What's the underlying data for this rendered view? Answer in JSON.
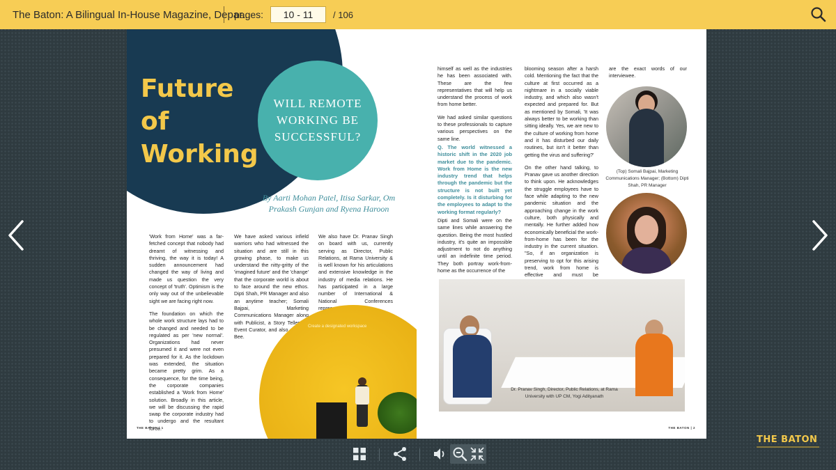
{
  "topbar": {
    "doc_title": "The Baton: A Bilingual In-House Magazine, Depar...",
    "pages_label": "pages:",
    "page_value": "10 - 11",
    "page_total": "/ 106",
    "search_icon": "search-icon"
  },
  "nav": {
    "prev_icon": "chevron-left-icon",
    "next_icon": "chevron-right-icon"
  },
  "spread": {
    "title_line1": "Future",
    "title_line2": "of",
    "title_line3": "Working",
    "teal_heading": "WILL REMOTE WORKING BE SUCCESSFUL?",
    "byline": "By Aarti Mohan Patel, Itisa Sarkar, Om Prakash Gunjan and Ryena Haroon",
    "col1_p1": "'Work from Home' was a far-fetched concept that nobody had dreamt of witnessing and thriving, the way it is today! A sudden announcement had changed the way of living and made us question the very concept of 'truth'. Optimism is the only way out of the unbelievable sight we are facing right now.",
    "col1_p2": "The foundation on which the whole work structure lays had to be changed and needed to be regulated as per 'new normal'. Organizations had never presumed it and were not even prepared for it. As the lockdown was extended, the situation became pretty grim. As a consequence, for the time being, the corporate companies established a 'Work from Home' solution. Broadly in this article, we will be discussing the rapid swap the corporate industry had to undergo and the resultant force.",
    "col2_p1": "We have asked various infield warriors who had witnessed the situation and are still in this growing phase, to make us understand the nitty-gritty of the 'imagined future' and the 'change' that the corporate world is about to face around the new ethos. Dipti Shah, PR Manager and also an anytime teacher; Somali Bajpai, Marketing Communications Manager along with Publicist, a Story Teller, an Event Curator, and also a Digital Bee.",
    "col3_p1": "We also have Dr. Pranav Singh on board with us, currently serving as Director, Public Relations, at Rama University & is well known for his articulations and extensive knowledge in the industry of media relations. He has participated in a large number of International & National Conferences representing",
    "yellow_caption": "Create a designated workspace",
    "footer_left": "THE BATON | 1",
    "footer_right": "THE BATON | 2",
    "rcol1_p1": "himself as well as the industries he has been associated with. These are the few representatives that will help us understand the process of work from home better.",
    "rcol1_p2": "We had asked similar questions to these professionals to capture various perspectives on the same line.",
    "question": "Q. The world witnessed a historic shift in the 2020 job market due to the pandemic. Work from Home is the new industry trend that helps through the pandemic but the structure is not built yet completely. Is it disturbing for the employees to adapt to the working format regularly?",
    "rcol1_p3": "Dipti and Somali were on the same lines while answering the question. Being the most hustled industry, it's quite an impossible adjustment to not do anything until an indefinite time period. They both portray work-from-home as the occurrence of the",
    "rcol2_p1": "blooming season after a harsh cold. Mentioning the fact that the culture at first occurred as a nightmare in a socially viable industry, and which also wasn't expected and prepared for. But as mentioned by Somali, 'It was always better to be working than sitting ideally. Yes, we are new to the culture of working from home and it has disturbed our daily routines, but isn't it better than getting the virus and suffering?'",
    "rcol2_p2": "On the other hand talking, to Pranav gave us another direction to think upon. He acknowledges the struggle employees have to face while adapting to the new pandemic situation and the approaching change in the work culture, both physically and mentally. He further added how economically beneficial the work-from-home has been for the industry in the current situation. \"So, if an organization is preserving to opt for this arising trend, work from home is effective and must be implemented by all.\"",
    "rcol3_p1": "are the exact words of our interviewee.",
    "photo_caption": "(Top) Somali Bajpai, Marketing Communications Manager; (Bottom) Dipti Shah, PR Manager",
    "office_caption": "Dr. Pranav Singh, Director, Public Relations, at Rama University with UP CM, Yogi Adityanath"
  },
  "toolbar": {
    "grid_icon": "thumbnails-grid-icon",
    "share_icon": "share-icon",
    "volume_icon": "volume-icon",
    "zoom_out_icon": "zoom-out-icon",
    "collapse_icon": "collapse-icon"
  },
  "brand": {
    "name": "THE BATON"
  },
  "colors": {
    "topbar": "#f7cd55",
    "navy": "#183a52",
    "teal": "#48b1ad",
    "title_yellow": "#f3c84a"
  }
}
